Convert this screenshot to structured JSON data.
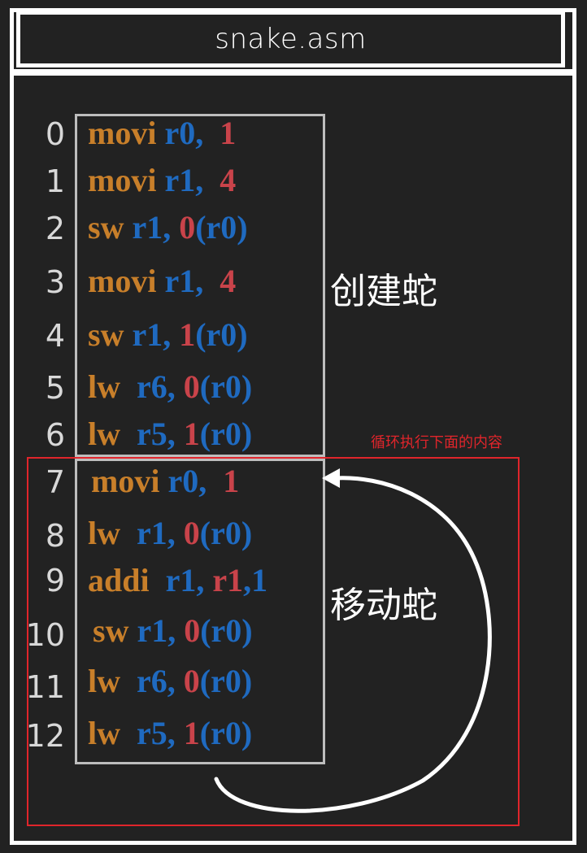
{
  "title": "snake.asm",
  "line_numbers": [
    "0",
    "1",
    "2",
    "3",
    "4",
    "5",
    "6",
    "7",
    "8",
    "9",
    "10",
    "11",
    "12"
  ],
  "code": [
    {
      "op": "movi",
      "r": "r0,",
      "n": "1",
      "rest": ""
    },
    {
      "op": "movi",
      "r": "r1,",
      "n": "4",
      "rest": ""
    },
    {
      "op": "sw",
      "r": "r1,",
      "n": "0",
      "rest": "(r0)"
    },
    {
      "op": "movi",
      "r": "r1,",
      "n": "4",
      "rest": ""
    },
    {
      "op": "sw",
      "r": "r1,",
      "n": "1",
      "rest": "(r0)"
    },
    {
      "op": "lw",
      "r": "r6,",
      "n": "0",
      "rest": "(r0)"
    },
    {
      "op": "lw",
      "r": "r5,",
      "n": "1",
      "rest": "(r0)"
    },
    {
      "op": "movi",
      "r": "r0,",
      "n": "1",
      "rest": ""
    },
    {
      "op": "lw",
      "r": "r1,",
      "n": "0",
      "rest": "(r0)"
    },
    {
      "op": "addi",
      "r": "r1,",
      "n": "r1",
      "rest": ",1"
    },
    {
      "op": "sw",
      "r": "r1,",
      "n": "0",
      "rest": "(r0)"
    },
    {
      "op": "lw",
      "r": "r6,",
      "n": "0",
      "rest": "(r0)"
    },
    {
      "op": "lw",
      "r": "r5,",
      "n": "1",
      "rest": "(r0)"
    }
  ],
  "labels": {
    "create_snake": "创建蛇",
    "move_snake": "移动蛇",
    "loop_note": "循环执行下面的内容"
  },
  "colors": {
    "opcode": "#c87f2a",
    "register": "#1f6ac0",
    "immediate": "#c9434a",
    "highlight_box": "#e0252b"
  }
}
